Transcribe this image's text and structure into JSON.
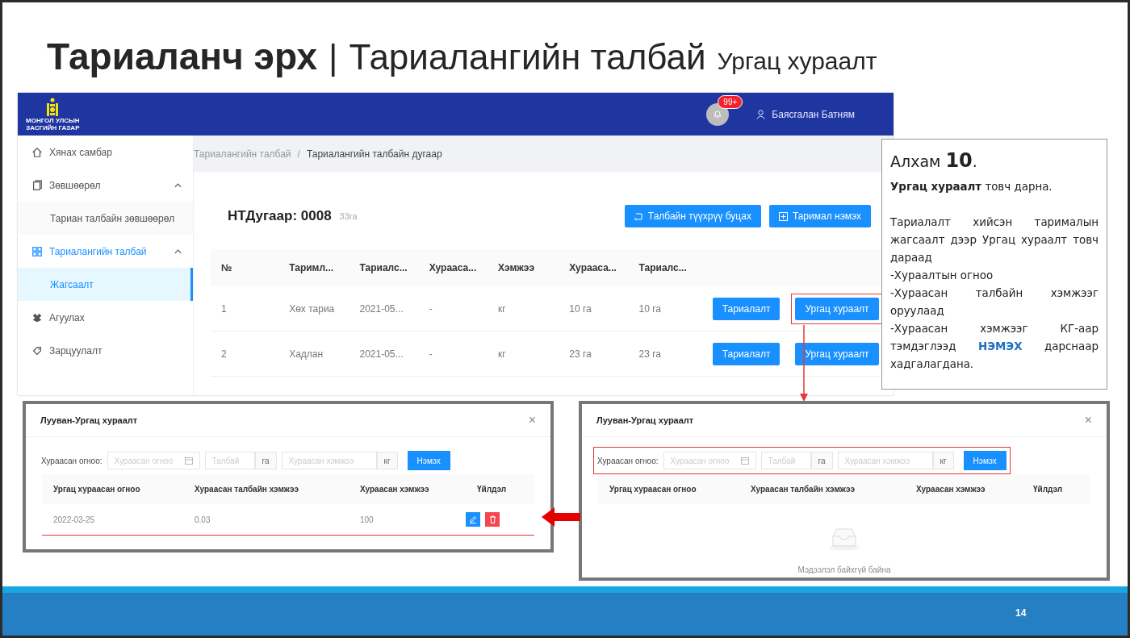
{
  "slide": {
    "title_bold": "Тариаланч эрх",
    "title_separator": "|",
    "title_main": "Тариалангийн талбай",
    "title_sub": "Ургац хураалт",
    "page_number": "14"
  },
  "app": {
    "logo_text": [
      "МОНГОЛ УЛСЫН",
      "ЗАСГИЙН ГАЗАР"
    ],
    "notification_badge": "99+",
    "user_name": "Баясгалан Батням",
    "sidebar": [
      {
        "label": "Хянах самбар",
        "selected": false
      },
      {
        "label": "Зөвшөөрөл",
        "selected": false,
        "expanded": true,
        "children": [
          {
            "label": "Тариан талбайн зөвшөөрөл",
            "selected": false
          }
        ]
      },
      {
        "label": "Тариалангийн талбай",
        "selected": true,
        "expanded": true,
        "children": [
          {
            "label": "Жагсаалт",
            "selected": true
          }
        ]
      },
      {
        "label": "Агуулах",
        "selected": false
      },
      {
        "label": "Зарцуулалт",
        "selected": false
      }
    ],
    "breadcrumb": [
      "Тариалангийн талбай",
      "/",
      "Тариалангийн талбайн дугаар"
    ],
    "heading": "НТДугаар: 0008",
    "area": "33га",
    "actions": [
      "Талбайн түүхрүү буцах",
      "Таримал нэмэх"
    ],
    "table": {
      "columns": [
        "№",
        "Таримл...",
        "Тариалс...",
        "Хурааса...",
        "Хэмжээ",
        "Хурааса...",
        "Тариалс..."
      ],
      "rows": [
        {
          "cells": [
            "1",
            "Хөх тариа",
            "2021-05...",
            "-",
            "кг",
            "10 га",
            "10 га"
          ],
          "actions": [
            {
              "label": "Тариалалт",
              "highlighted": false
            },
            {
              "label": "Ургац хураалт",
              "highlighted": true
            }
          ]
        },
        {
          "cells": [
            "2",
            "Хадлан",
            "2021-05...",
            "-",
            "кг",
            "23 га",
            "23 га"
          ],
          "actions": [
            {
              "label": "Тариалалт",
              "highlighted": false
            },
            {
              "label": "Ургац хураалт",
              "highlighted": false
            }
          ]
        }
      ]
    }
  },
  "step_note": {
    "title": "Алхам **10**.",
    "paragraphs": [
      {
        "kind": "lead",
        "text": "**Ургац хураалт** товч дарна."
      },
      {
        "kind": "body",
        "text": "Тариалалт хийсэн тарималын жагсаалт дээр Ургац хураалт товч дараад"
      },
      {
        "kind": "body",
        "text": "-Хураалтын огноо"
      },
      {
        "kind": "body",
        "text": "-Хураасан талбайн хэмжээг оруулаад"
      },
      {
        "kind": "save",
        "text": "-Хураасан хэмжээг КГ-аар тэмдэглээд **НЭМЭХ** дарснаар хадгалагдана."
      }
    ]
  },
  "modals": [
    {
      "title": "Лууван-Ургац хураалт",
      "close": "×",
      "date_label": "Хураасан огноо:",
      "date_placeholder": "Хураасан огноо",
      "area_placeholder": "Талбай",
      "area_unit": "га",
      "amount_placeholder": "Хураасан хэмжээ",
      "amount_unit": "кг",
      "add_button": "Нэмэх",
      "form_highlighted": false,
      "columns": [
        "Ургац хураасан огноо",
        "Хураасан талбайн хэмжээ",
        "Хураасан хэмжээ",
        "Үйлдэл"
      ],
      "rows": [
        {
          "cells": [
            "2022-03-25",
            "0.03",
            "100"
          ],
          "underlined": true
        }
      ]
    },
    {
      "title": "Лууван-Ургац хураалт",
      "close": "×",
      "date_label": "Хураасан огноо:",
      "date_placeholder": "Хураасан огноо",
      "area_placeholder": "Талбай",
      "area_unit": "га",
      "amount_placeholder": "Хураасан хэмжээ",
      "amount_unit": "кг",
      "add_button": "Нэмэх",
      "form_highlighted": true,
      "columns": [
        "Ургац хураасан огноо",
        "Хураасан талбайн хэмжээ",
        "Хураасан хэмжээ",
        "Үйлдэл"
      ],
      "empty_text": "Мэдээлэл байхгүй байна"
    }
  ]
}
